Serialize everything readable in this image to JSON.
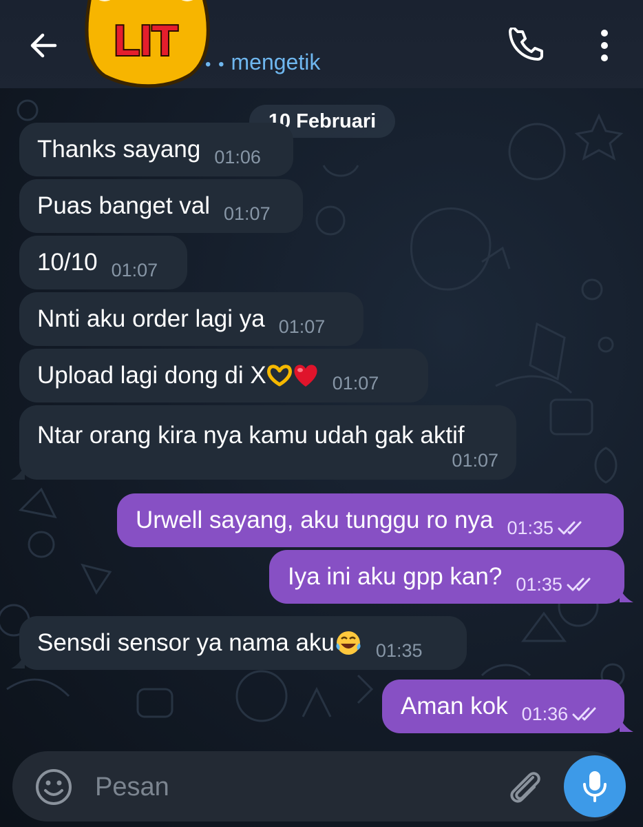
{
  "header": {
    "avatar_text": "LIT",
    "status_text": "mengetik",
    "status_dots": "• •"
  },
  "date_chip": "10 Februari",
  "messages": [
    {
      "dir": "in",
      "text": "Thanks sayang",
      "time": "01:06"
    },
    {
      "dir": "in",
      "text": "Puas banget val",
      "time": "01:07"
    },
    {
      "dir": "in",
      "text": "10/10",
      "time": "01:07"
    },
    {
      "dir": "in",
      "text": "Nnti aku order lagi ya",
      "time": "01:07"
    },
    {
      "dir": "in",
      "text": "Upload lagi dong di X",
      "emoji": [
        "heart-hands",
        "red-heart"
      ],
      "time": "01:07"
    },
    {
      "dir": "in",
      "text": "Ntar orang kira nya kamu udah gak aktif",
      "time": "01:07"
    },
    {
      "dir": "out",
      "text": "Urwell sayang, aku tunggu ro nya",
      "time": "01:35",
      "status": "read"
    },
    {
      "dir": "out",
      "text": "Iya ini aku gpp kan?",
      "time": "01:35",
      "status": "read"
    },
    {
      "dir": "in",
      "text": "Sensdi sensor ya nama aku",
      "emoji": [
        "tears-of-joy"
      ],
      "time": "01:35"
    },
    {
      "dir": "out",
      "text": "Aman kok",
      "time": "01:36",
      "status": "read"
    }
  ],
  "input": {
    "placeholder": "Pesan"
  },
  "icons": {
    "back": "arrow-left-icon",
    "call": "phone-icon",
    "more": "more-vertical-icon",
    "emoji": "smile-icon",
    "attach": "paperclip-icon",
    "mic": "microphone-icon"
  },
  "colors": {
    "incoming_bubble": "#222c38",
    "outgoing_bubble": "#8750c4",
    "accent": "#3d9ae8",
    "typing": "#6fb7ef"
  }
}
